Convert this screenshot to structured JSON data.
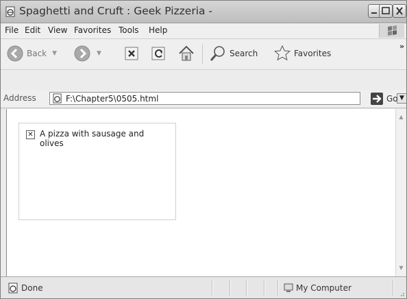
{
  "window": {
    "title": "Spaghetti and Cruft : Geek Pizzeria -",
    "buttons": {
      "minimize": "minimize-icon",
      "maximize": "maximize-icon",
      "close": "close-icon"
    }
  },
  "menu": {
    "items": [
      {
        "label": "File"
      },
      {
        "label": "Edit"
      },
      {
        "label": "View"
      },
      {
        "label": "Favorites"
      },
      {
        "label": "Tools"
      },
      {
        "label": "Help"
      }
    ]
  },
  "toolbar": {
    "back_label": "Back",
    "search_label": "Search",
    "favorites_label": "Favorites"
  },
  "address": {
    "label": "Address",
    "value": "F:\\Chapter5\\0505.html",
    "go_label": "Go"
  },
  "page": {
    "image_alt": "A pizza with sausage and olives"
  },
  "status": {
    "text": "Done",
    "zone": "My Computer"
  }
}
